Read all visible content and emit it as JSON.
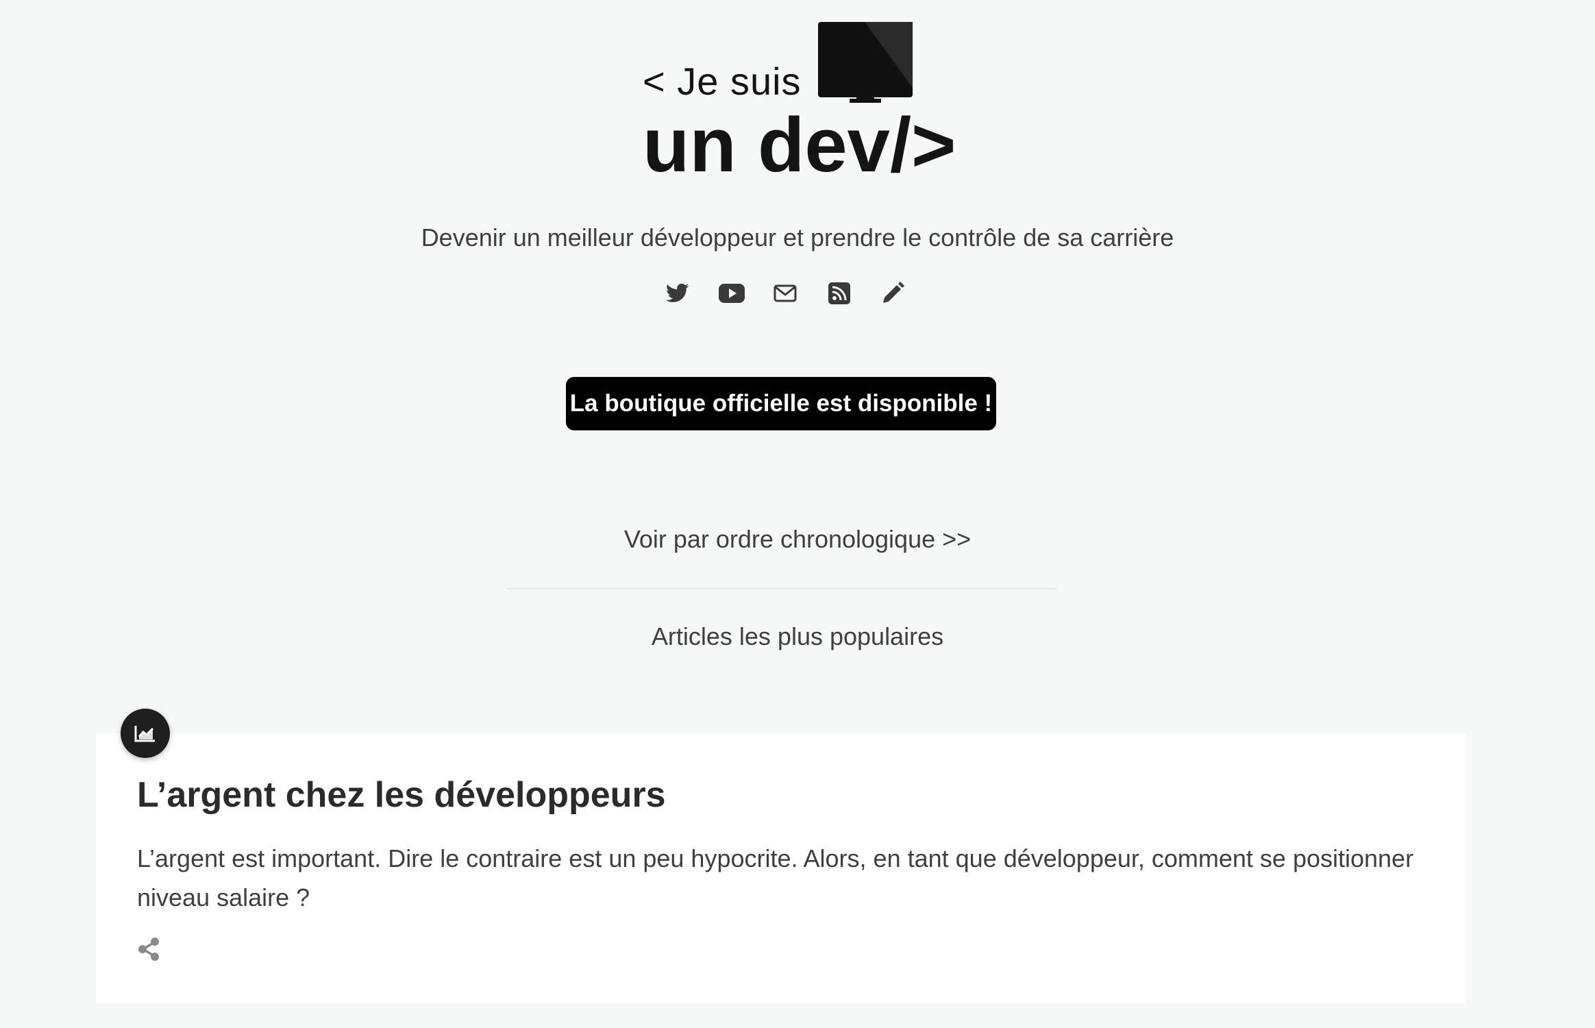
{
  "site": {
    "logo_text_line1": "< Je suis",
    "logo_text_line2": "un dev/>",
    "tagline": "Devenir un meilleur développeur et prendre le contrôle de sa carrière"
  },
  "social_icons": [
    "twitter-icon",
    "youtube-icon",
    "email-icon",
    "rss-icon",
    "pencil-icon"
  ],
  "shop_button": {
    "label": "La boutique officielle est disponible !"
  },
  "chrono_link": {
    "label": "Voir par ordre chronologique >>"
  },
  "popular": {
    "heading": "Articles les plus populaires"
  },
  "article": {
    "badge_icon": "trending-chart-icon",
    "title": "L’argent chez les développeurs",
    "excerpt": "L’argent est important. Dire le contraire est un peu hypocrite. Alors, en tant que développeur, comment se positionner niveau salaire ?",
    "share_icon": "share-icon"
  },
  "colors": {
    "background": "#f6f7f7",
    "card": "#ffffff",
    "button": "#000000",
    "text": "#3f3f3f"
  }
}
